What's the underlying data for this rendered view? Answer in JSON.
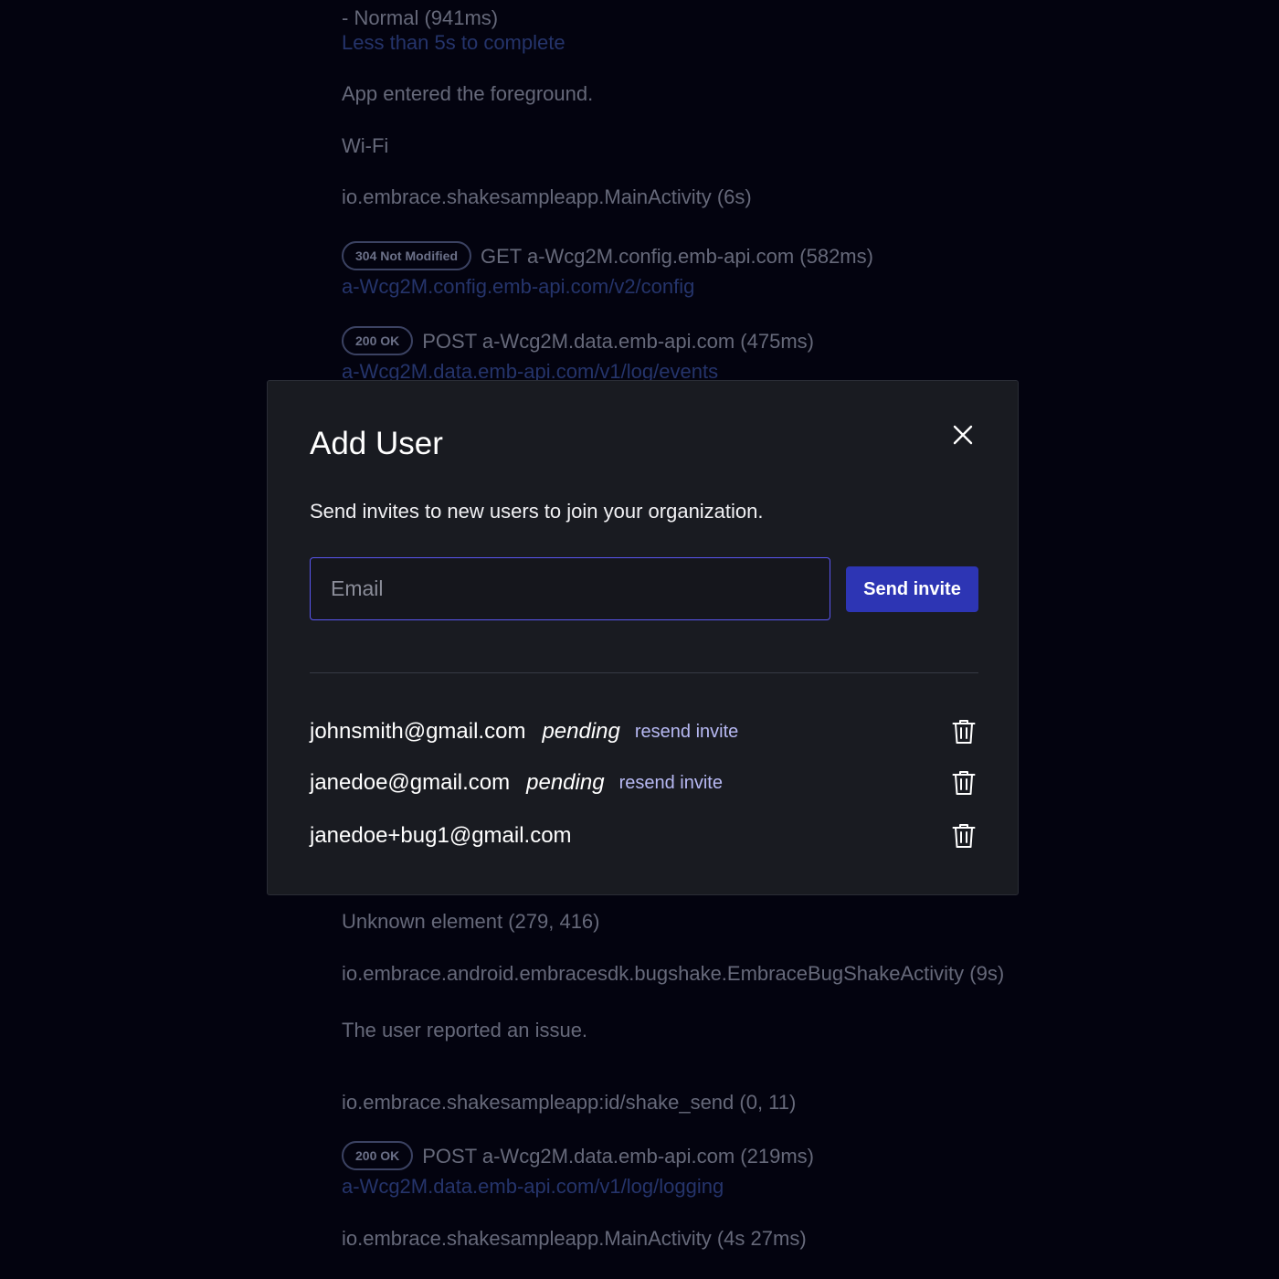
{
  "background": {
    "startup_value": "- Normal (941ms)",
    "startup_hint": "Less than 5s to complete",
    "foreground_event": "App entered the foreground.",
    "network_type": "Wi-Fi",
    "main_activity_1": "io.embrace.shakesampleapp.MainActivity (6s)",
    "request_1": {
      "badge": "304 Not Modified",
      "title": "GET a-Wcg2M.config.emb-api.com (582ms)",
      "url": "a-Wcg2M.config.emb-api.com/v2/config"
    },
    "request_2": {
      "badge": "200 OK",
      "title": "POST a-Wcg2M.data.emb-api.com (475ms)",
      "url": "a-Wcg2M.data.emb-api.com/v1/log/events"
    },
    "unknown_element": "Unknown element (279, 416)",
    "bugshake_activity": "io.embrace.android.embracesdk.bugshake.EmbraceBugShakeActivity (9s)",
    "issue_reported": "The user reported an issue.",
    "tap_element": "io.embrace.shakesampleapp:id/shake_send (0, 11)",
    "request_3": {
      "badge": "200 OK",
      "title": "POST a-Wcg2M.data.emb-api.com (219ms)",
      "url": "a-Wcg2M.data.emb-api.com/v1/log/logging"
    },
    "main_activity_2": "io.embrace.shakesampleapp.MainActivity (4s 27ms)"
  },
  "modal": {
    "title": "Add User",
    "close_icon": "close-icon",
    "subtitle": "Send invites to new users to join your organization.",
    "email_input": {
      "placeholder": "Email",
      "value": ""
    },
    "send_button": "Send invite",
    "users": [
      {
        "email": "johnsmith@gmail.com",
        "status": "pending",
        "action": "resend invite",
        "icon": "trash-icon"
      },
      {
        "email": "janedoe@gmail.com",
        "status": "pending",
        "action": "resend invite",
        "icon": "trash-icon"
      },
      {
        "email": "janedoe+bug1@gmail.com",
        "status": "",
        "action": "",
        "icon": "trash-icon"
      }
    ]
  },
  "colors": {
    "page_background": "#03030f",
    "modal_background": "#191b21",
    "accent": "#2d35b4",
    "input_border": "#5a56f0",
    "link": "#b7b9f3"
  }
}
